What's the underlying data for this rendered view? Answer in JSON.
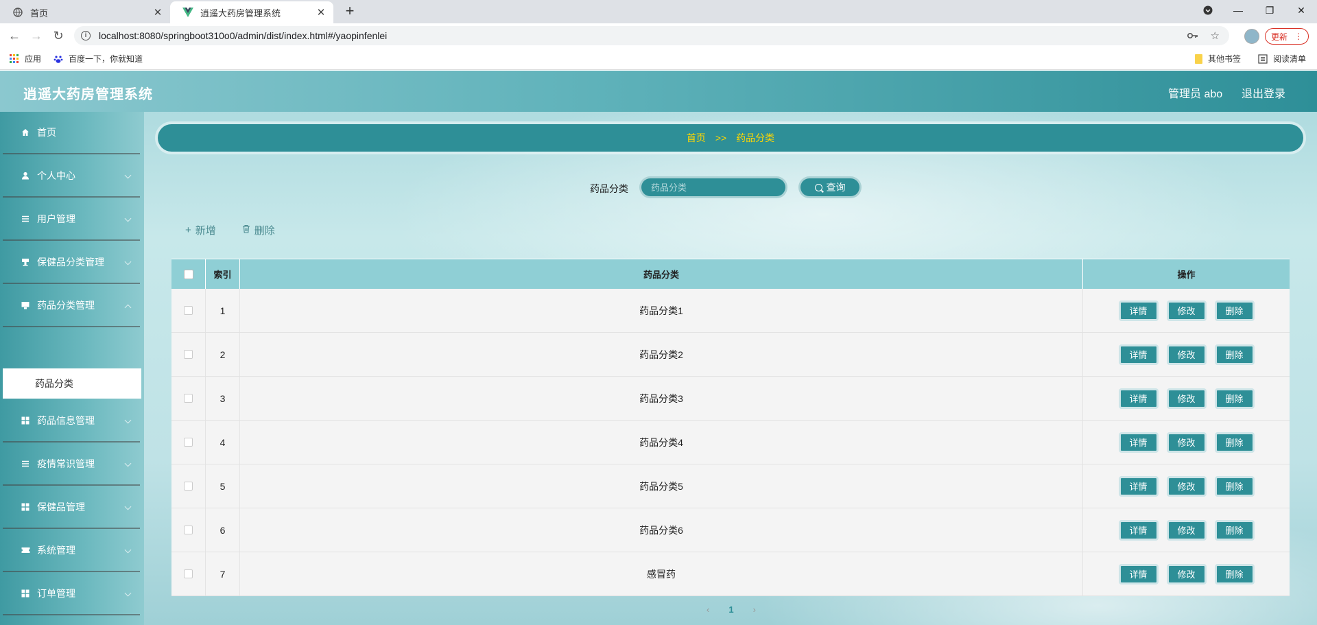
{
  "browser": {
    "tabs": [
      {
        "title": "首页",
        "active": false
      },
      {
        "title": "逍遥大药房管理系统",
        "active": true
      }
    ],
    "url": "localhost:8080/springboot310o0/admin/dist/index.html#/yaopinfenlei",
    "update_label": "更新",
    "bookmarks": {
      "apps": "应用",
      "baidu": "百度一下，你就知道",
      "other": "其他书签",
      "reading": "阅读清单"
    }
  },
  "app": {
    "title": "逍遥大药房管理系统",
    "user": "管理员 abo",
    "logout": "退出登录",
    "accent_color": "#2e8f97",
    "sidebar": [
      {
        "label": "首页",
        "icon": "home-icon"
      },
      {
        "label": "个人中心",
        "icon": "user-icon"
      },
      {
        "label": "用户管理",
        "icon": "list-icon"
      },
      {
        "label": "保健品分类管理",
        "icon": "stamp-icon"
      },
      {
        "label": "药品分类管理",
        "icon": "monitor-icon"
      },
      {
        "label": "药品信息管理",
        "icon": "grid-icon"
      },
      {
        "label": "疫情常识管理",
        "icon": "list-icon"
      },
      {
        "label": "保健品管理",
        "icon": "grid-icon"
      },
      {
        "label": "系统管理",
        "icon": "ticket-icon"
      },
      {
        "label": "订单管理",
        "icon": "grid-icon"
      }
    ],
    "active_submenu": "药品分类",
    "breadcrumb": {
      "home": "首页",
      "sep": ">>",
      "current": "药品分类"
    },
    "search": {
      "label": "药品分类",
      "placeholder": "药品分类",
      "button": "查询"
    },
    "actions": {
      "add": "新增",
      "delete": "删除"
    },
    "table": {
      "headers": {
        "index": "索引",
        "name": "药品分类",
        "ops": "操作"
      },
      "rows": [
        {
          "index": "1",
          "name": "药品分类1"
        },
        {
          "index": "2",
          "name": "药品分类2"
        },
        {
          "index": "3",
          "name": "药品分类3"
        },
        {
          "index": "4",
          "name": "药品分类4"
        },
        {
          "index": "5",
          "name": "药品分类5"
        },
        {
          "index": "6",
          "name": "药品分类6"
        },
        {
          "index": "7",
          "name": "感冒药"
        }
      ],
      "row_buttons": {
        "detail": "详情",
        "edit": "修改",
        "delete": "删除"
      }
    },
    "pager": {
      "prev": "‹",
      "current": "1",
      "next": "›"
    }
  }
}
